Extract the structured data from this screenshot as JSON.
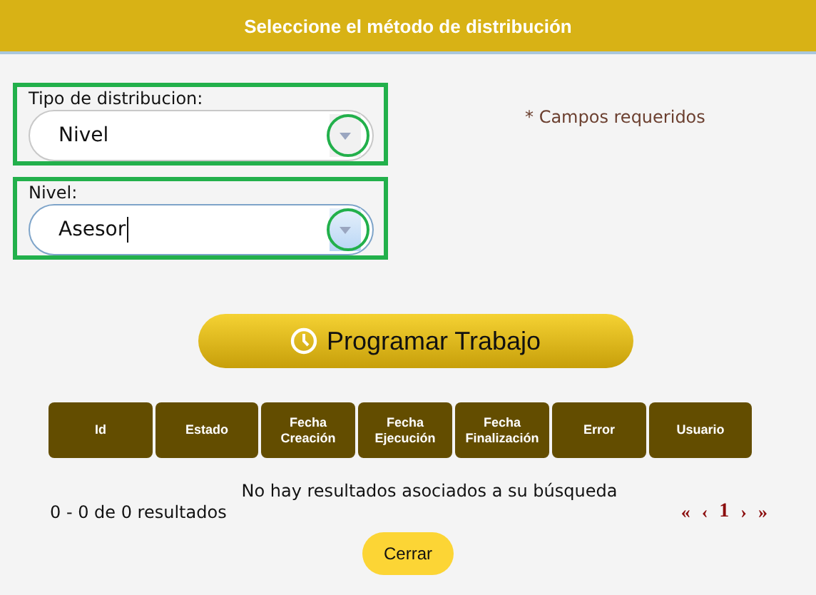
{
  "header": {
    "title": "Seleccione el método de distribución"
  },
  "required_note": "* Campos requeridos",
  "fields": [
    {
      "label": "Tipo de distribucion:",
      "value": "Nivel",
      "highlighted": true,
      "focused": false
    },
    {
      "label": "Nivel:",
      "value": "Asesor",
      "highlighted": true,
      "focused": true
    }
  ],
  "schedule_button": {
    "label": "Programar Trabajo"
  },
  "table": {
    "columns": [
      "Id",
      "Estado",
      "Fecha Creación",
      "Fecha Ejecución",
      "Fecha Finalización",
      "Error",
      "Usuario"
    ],
    "empty_message": "No hay resultados asociados a su búsqueda"
  },
  "summary": "0 - 0 de 0 resultados",
  "pagination": [
    {
      "label": "«",
      "kind": "nav"
    },
    {
      "label": "‹",
      "kind": "nav"
    },
    {
      "label": "1",
      "kind": "page"
    },
    {
      "label": "›",
      "kind": "nav"
    },
    {
      "label": "»",
      "kind": "nav"
    }
  ],
  "close_button": {
    "label": "Cerrar"
  }
}
